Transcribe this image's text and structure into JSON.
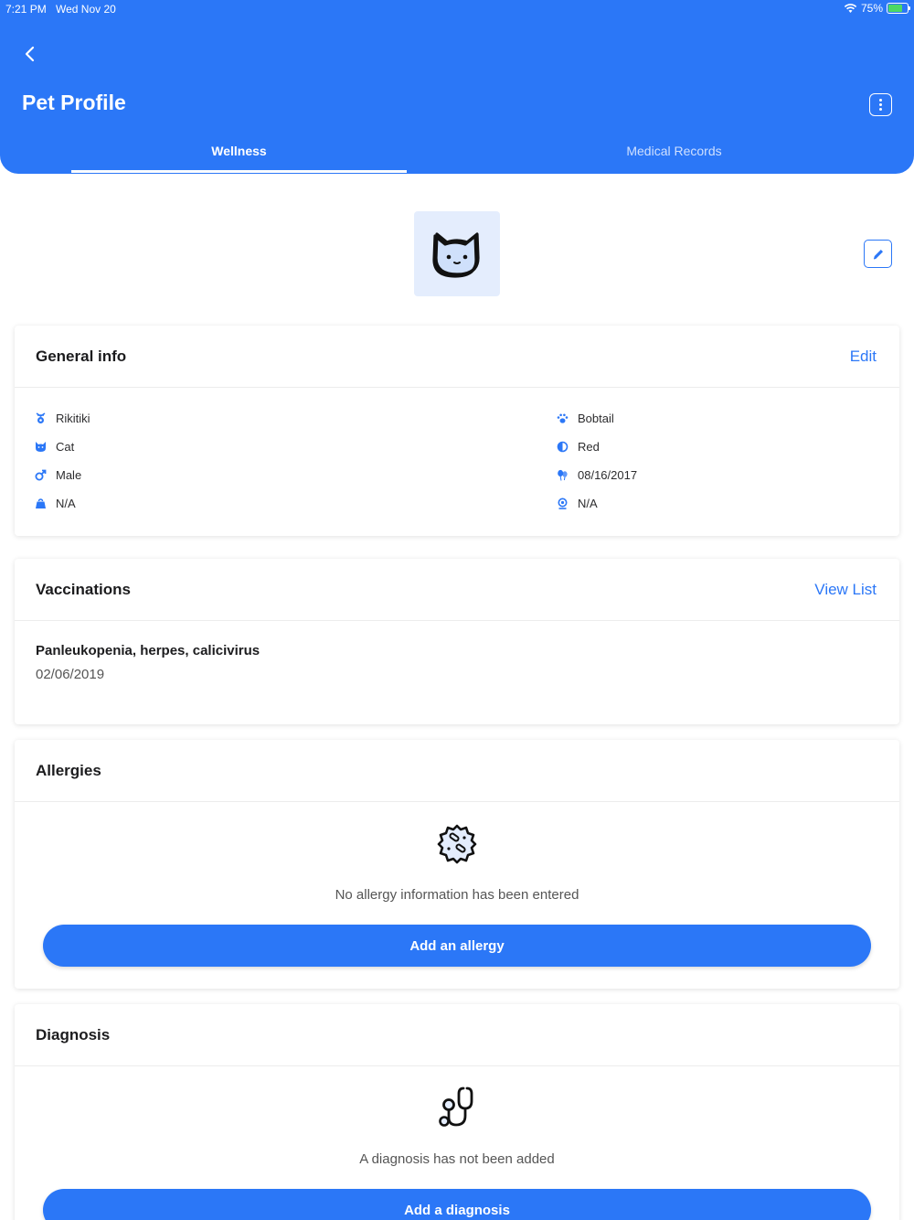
{
  "status_bar": {
    "time": "7:21 PM",
    "date": "Wed Nov 20",
    "battery": "75%",
    "battery_level": 0.75
  },
  "header": {
    "title": "Pet Profile",
    "tabs": [
      {
        "label": "Wellness",
        "active": true
      },
      {
        "label": "Medical Records",
        "active": false
      }
    ]
  },
  "colors": {
    "accent": "#2b77f7",
    "avatar_bg": "#e4edfd"
  },
  "avatar": {
    "icon": "cat-face-icon"
  },
  "general_info": {
    "title": "General info",
    "action": "Edit",
    "left": [
      {
        "icon": "name-tag-icon",
        "value": "Rikitiki"
      },
      {
        "icon": "cat-icon",
        "value": "Cat"
      },
      {
        "icon": "male-icon",
        "value": "Male"
      },
      {
        "icon": "weight-icon",
        "value": "N/A"
      }
    ],
    "right": [
      {
        "icon": "paw-icon",
        "value": "Bobtail"
      },
      {
        "icon": "color-icon",
        "value": "Red"
      },
      {
        "icon": "birthday-icon",
        "value": "08/16/2017"
      },
      {
        "icon": "microchip-icon",
        "value": "N/A"
      }
    ]
  },
  "vaccinations": {
    "title": "Vaccinations",
    "action": "View List",
    "items": [
      {
        "name": "Panleukopenia, herpes, calicivirus",
        "date": "02/06/2019"
      }
    ]
  },
  "allergies": {
    "title": "Allergies",
    "empty_text": "No allergy information has been entered",
    "button": "Add an allergy",
    "icon": "allergy-icon"
  },
  "diagnosis": {
    "title": "Diagnosis",
    "empty_text": "A diagnosis has not been added",
    "button": "Add a diagnosis",
    "icon": "stethoscope-icon"
  }
}
